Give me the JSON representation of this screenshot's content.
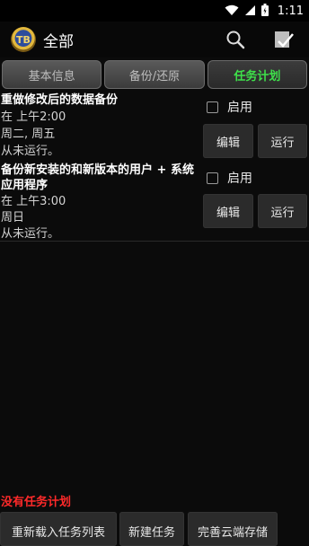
{
  "status_bar": {
    "time": "1:11"
  },
  "app_bar": {
    "title": "全部",
    "logo_text": "TB"
  },
  "tabs": [
    {
      "label": "基本信息"
    },
    {
      "label": "备份/还原"
    },
    {
      "label": "任务计划"
    }
  ],
  "schedules": [
    {
      "name": "重做修改后的数据备份",
      "time": "在 上午2:00",
      "days": "周二, 周五",
      "last_run": "从未运行。",
      "enable_label": "启用",
      "edit_label": "编辑",
      "run_label": "运行"
    },
    {
      "name_line1": "备份新安装的和新版本的用户 + 系统",
      "name_line2": "应用程序",
      "time": "在 上午3:00",
      "days": "周日",
      "last_run": "从未运行。",
      "enable_label": "启用",
      "edit_label": "编辑",
      "run_label": "运行"
    }
  ],
  "footer": {
    "status": "没有任务计划",
    "buttons": [
      "重新载入任务列表",
      "新建任务",
      "完善云端存储"
    ]
  },
  "colors": {
    "active_tab": "#3ee04a",
    "warning": "#ff2a2a"
  }
}
